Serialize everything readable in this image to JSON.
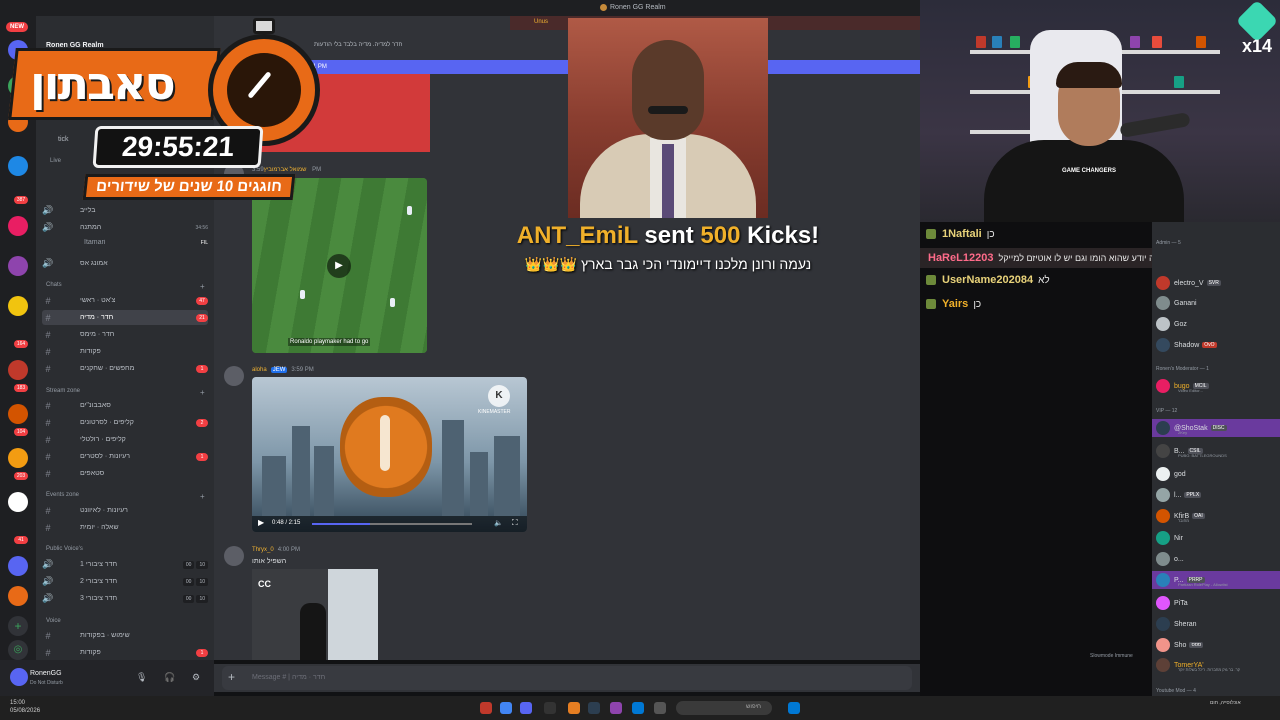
{
  "window": {
    "title": "Ronen GG Realm"
  },
  "server": {
    "name": "Ronen GG Realm",
    "new_badge": "NEW"
  },
  "rail": {
    "badges": [
      "387",
      "164",
      "183",
      "520",
      "104",
      "99",
      "203",
      "59",
      "41",
      "394"
    ]
  },
  "banners": {
    "unused": "Unus",
    "channel_topic": "חדר למדיה. מדיה בלבד בלי הודעות",
    "jump_bar": "11 PM"
  },
  "sidebar": {
    "partial_top": "tick",
    "live_label": "Live",
    "channels_top": [
      {
        "label": "בלייב"
      },
      {
        "label": "המתנה",
        "extra": "34:56"
      },
      {
        "label": "Itamari",
        "extra": "FIL"
      },
      {
        "label": "אמונג אס"
      }
    ],
    "chats_category": "Chats",
    "chats": [
      {
        "label": "צ'אט · ראשי",
        "count": "47"
      },
      {
        "label": "חדר · מדיה",
        "count": "21",
        "active": true
      },
      {
        "label": "חדר · מימס"
      },
      {
        "label": "פקודות"
      },
      {
        "label": "מחפשים · שחקנים",
        "count": "1"
      }
    ],
    "stream_category": "Stream zone",
    "stream": [
      {
        "label": "סאבבונ\"ים"
      },
      {
        "label": "קליפים · לסרטונים",
        "count": "2"
      },
      {
        "label": "קליפים · רולטלי"
      },
      {
        "label": "רעיונות · לסטרים",
        "count": "1"
      },
      {
        "label": "סטאפים"
      }
    ],
    "events_category": "Events zone",
    "events": [
      {
        "label": "רעיונות · לאיוונט"
      },
      {
        "label": "שאלה · יומית"
      }
    ],
    "public_voice_category": "Public Voice's",
    "public_voice": [
      {
        "label": "חדר ציבורי 1",
        "a": "00",
        "b": "10"
      },
      {
        "label": "חדר ציבורי 2",
        "a": "00",
        "b": "10"
      },
      {
        "label": "חדר ציבורי 3",
        "a": "00",
        "b": "10"
      }
    ],
    "voice_category": "Voice",
    "voice": [
      {
        "label": "שימוש · בפקודות"
      },
      {
        "label": "פקודות",
        "count": "1"
      }
    ]
  },
  "user": {
    "name": "RonenGG",
    "status": "Do Not Disturb"
  },
  "messages": [
    {
      "author": "שמואל אברמוביץ",
      "time": "3:59 PM",
      "caption": "Ronaldo playmaker had to go"
    },
    {
      "author": "aloha",
      "tag": "JEW",
      "time": "3:59 PM",
      "video_time": "0:48 / 2:15",
      "watermark": "KINEMASTER"
    },
    {
      "author": "Thryx_0",
      "time": "4:00 PM",
      "text": "השפיל אותו",
      "logo_text": "CC"
    }
  ],
  "input": {
    "placeholder": "Message # | חדר · מדיה"
  },
  "overlay": {
    "logo_word": "סאבתון",
    "timer": "29:55:21",
    "subtitle": "חוגגים 10 שנים של שידורים",
    "alert_user": "ANT_EmiL",
    "alert_sent": "sent",
    "alert_amount": "500",
    "alert_unit": "Kicks!",
    "alert_message": "נעמה ורונן מלכנו דיימונדי הכי גבר בארץ 👑👑👑"
  },
  "cam": {
    "badge": "x14",
    "shirt": "GAME CHANGERS"
  },
  "kick_chat": [
    {
      "name": "1Naftali",
      "text": "כן",
      "color": "#e8d27a"
    },
    {
      "name": "HaReL12203",
      "text": "רונן אתה יודע שהוא הומו וגם יש לו אוטיזם למייקל",
      "color": "#ff6b8a",
      "highlight": true
    },
    {
      "name": "UserName202084",
      "text": "לא",
      "color": "#e8d27a"
    },
    {
      "name": "Yairs",
      "text": "כן",
      "color": "#f0b02a"
    }
  ],
  "members": {
    "section1": "Admin — 5",
    "admins": [
      {
        "name": "electro_V",
        "tag": "SVR"
      },
      {
        "name": "Ganani"
      },
      {
        "name": "Goz"
      },
      {
        "name": "Shadow",
        "tag": "OvO"
      }
    ],
    "section2": "Ronen's Moderator — 1",
    "mods": [
      {
        "name": "bugo",
        "tag": "MCIL",
        "activity": "Video Editor..."
      }
    ],
    "section3": "VIP — 12",
    "vips": [
      {
        "name": "@ShoStak",
        "tag": "DISC",
        "activity": "2Key",
        "boost": true
      },
      {
        "name": "B...",
        "tag": "CSIL",
        "activity": "PUBG: BATTLEGROUNDS"
      },
      {
        "name": "god"
      },
      {
        "name": "l...",
        "tag": "PPLX"
      },
      {
        "name": "KfirB",
        "tag": "OAI",
        "activity": "מחובר"
      },
      {
        "name": "Nir"
      },
      {
        "name": "o..."
      },
      {
        "name": "P...",
        "tag": "PRRP",
        "activity": "Partizan RolePlay - Allowlist",
        "boost": true
      },
      {
        "name": "PiTa"
      },
      {
        "name": "Sheran"
      },
      {
        "name": "Sho",
        "tag": "ססס"
      },
      {
        "name": "TomerYA'",
        "activity": "קר. בר גזק מחברות. ריכל בשלות יוקר"
      }
    ],
    "section4": "Youtube Mod — 4",
    "slowmode": "Slowmode Immune"
  },
  "taskbar": {
    "time": "15:00",
    "date": "05/08/2026",
    "search": "חיפוש",
    "region": "אוכלוסייה, חום"
  }
}
